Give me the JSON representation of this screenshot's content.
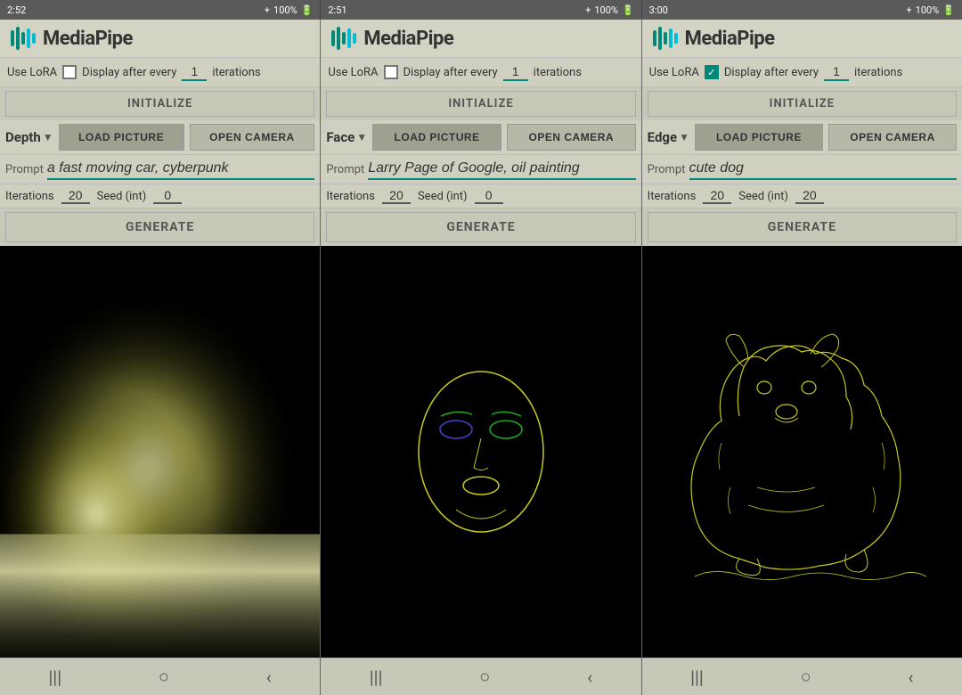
{
  "panels": [
    {
      "id": "panel-1",
      "statusLeft": "2:52",
      "statusRight": "100%",
      "appTitle": "MediaPipe",
      "useLoraLabel": "Use LoRA",
      "loraChecked": false,
      "displayAfterLabel": "Display after every",
      "displayAfterValue": "1",
      "iterationsLabel": "iterations",
      "initLabel": "INITIALIZE",
      "mode": "Depth",
      "loadPictureLabel": "LOAD PICTURE",
      "openCameraLabel": "OPEN CAMERA",
      "promptLabel": "Prompt",
      "promptValue": "a fast moving car, cyberpunk",
      "iterationsFieldLabel": "Iterations",
      "iterationsValue": "20",
      "seedLabel": "Seed (int)",
      "seedValue": "0",
      "generateLabel": "GENERATE",
      "imageType": "depth",
      "navItems": [
        "|||",
        "○",
        "<"
      ]
    },
    {
      "id": "panel-2",
      "statusLeft": "2:51",
      "statusRight": "100%",
      "appTitle": "MediaPipe",
      "useLoraLabel": "Use LoRA",
      "loraChecked": false,
      "displayAfterLabel": "Display after every",
      "displayAfterValue": "1",
      "iterationsLabel": "iterations",
      "initLabel": "INITIALIZE",
      "mode": "Face",
      "loadPictureLabel": "LOAD PICTURE",
      "openCameraLabel": "OPEN CAMERA",
      "promptLabel": "Prompt",
      "promptValue": "Larry Page of Google, oil painting",
      "iterationsFieldLabel": "Iterations",
      "iterationsValue": "20",
      "seedLabel": "Seed (int)",
      "seedValue": "0",
      "generateLabel": "GENERATE",
      "imageType": "face",
      "navItems": [
        "|||",
        "○",
        "<"
      ]
    },
    {
      "id": "panel-3",
      "statusLeft": "3:00",
      "statusRight": "100%",
      "appTitle": "MediaPipe",
      "useLoraLabel": "Use LoRA",
      "loraChecked": true,
      "displayAfterLabel": "Display after every",
      "displayAfterValue": "1",
      "iterationsLabel": "iterations",
      "initLabel": "INITIALIZE",
      "mode": "Edge",
      "loadPictureLabel": "LOAD PICTURE",
      "openCameraLabel": "OPEN CAMERA",
      "promptLabel": "Prompt",
      "promptValue": "cute dog",
      "iterationsFieldLabel": "Iterations",
      "iterationsValue": "20",
      "seedLabel": "Seed (int)",
      "seedValue": "20",
      "generateLabel": "GENERATE",
      "imageType": "dog",
      "navItems": [
        "|||",
        "○",
        "<"
      ]
    }
  ],
  "colors": {
    "teal": "#00897b",
    "bg": "#c8c8b8",
    "darkBg": "#5a5a5a"
  }
}
